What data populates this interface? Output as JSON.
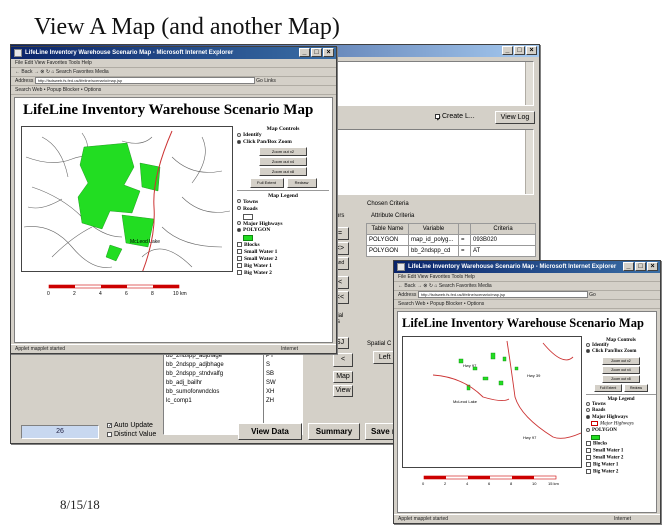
{
  "slide": {
    "title": "View A Map (and another Map)",
    "date": "8/15/18"
  },
  "browser": {
    "title": "LifeLine Inventory Warehouse Scenario Map - Microsoft Internet Explorer",
    "menu": "File  Edit  View  Favorites  Tools  Help",
    "toolbar": "← Back  →  ⊗  ↻  ⌂   Search   Favorites   Media",
    "address_label": "Address",
    "address_value": "http://lsdsweb.fs.fed.us/lifeline/scenario/map.jsp",
    "go": "Go",
    "links": "Links",
    "links_bar": "Search Web   •   Popup Blocker   •   Options",
    "status": "Applet mapplet started",
    "zone": "Internet"
  },
  "map": {
    "page_title": "LifeLine Inventory Warehouse Scenario Map",
    "controls_heading": "Map Controls",
    "identify": "Identify",
    "pan_zoom": "Click Pan/Box Zoom",
    "zoom_out_x2": "Zoom out x2",
    "zoom_out_x4": "Zoom out x4",
    "zoom_out_x8": "Zoom out x8",
    "full_extent": "Full Extent",
    "redraw": "Redraw",
    "legend_heading": "Map Legend",
    "towns": "Towns",
    "roads": "Roads",
    "major_highways": "Major Highways",
    "polygon": "POLYGON",
    "blocks": "Blocks",
    "small_water_1": "Small Water 1",
    "small_water_2": "Small Water 2",
    "big_water_1": "Big Water 1",
    "big_water_2": "Big Water 2",
    "town_label": "McLeod Lake",
    "scale_ticks": [
      "0",
      "2",
      "4",
      "6",
      "8",
      "10 km"
    ],
    "colors": {
      "polygon": "#22dd22",
      "highway": "#cc3333",
      "roads": "#555555"
    }
  },
  "map2": {
    "major_highways_sub": "Major Highways",
    "town_label": "McLeod Lake",
    "hwy_labels": [
      "Hwy 97",
      "Hwy 39",
      "Hwy 97"
    ],
    "scale_ticks": [
      "0",
      "2",
      "4",
      "6",
      "8",
      "10",
      "15 km"
    ]
  },
  "app": {
    "create_label": "Create L...",
    "view_log": "View Log",
    "chosen_criteria": "Chosen Criteria",
    "attribute_criteria": "Attribute Criteria",
    "operators": "rators",
    "col_headers": [
      "Table Name",
      "Variable",
      "",
      "Criteria"
    ],
    "rows": [
      [
        "POLYGON",
        "map_id_polyg...",
        "=",
        "093B020"
      ],
      [
        "POLYGON",
        "bb_2ndspp_cd",
        "=",
        "AT"
      ]
    ],
    "op_buttons": [
      "=",
      "<>",
      "and",
      "<",
      "<<"
    ],
    "spatial_label": "patial\nions",
    "spatial_c": "Spatial C",
    "left_e": "Left E",
    "variables": [
      "bb_2ndspp_adjbfage",
      "bb_2ndspp_adjbhage",
      "bb_2ndspp_stndvalfg",
      "bb_adj_bailhr",
      "bb_sumoforwndclos",
      "lc_comp1"
    ],
    "values": [
      "PY",
      "S",
      "SB",
      "SW",
      "XH",
      "ZH"
    ],
    "btn_SJ": "SJ",
    "btn_lt": "<",
    "btn_map": "Map",
    "btn_view": "View",
    "count": "26",
    "auto_update": "Auto Update",
    "distinct_value": "Distinct Value",
    "view_data": "View Data",
    "summary": "Summary",
    "save": "Save r"
  }
}
